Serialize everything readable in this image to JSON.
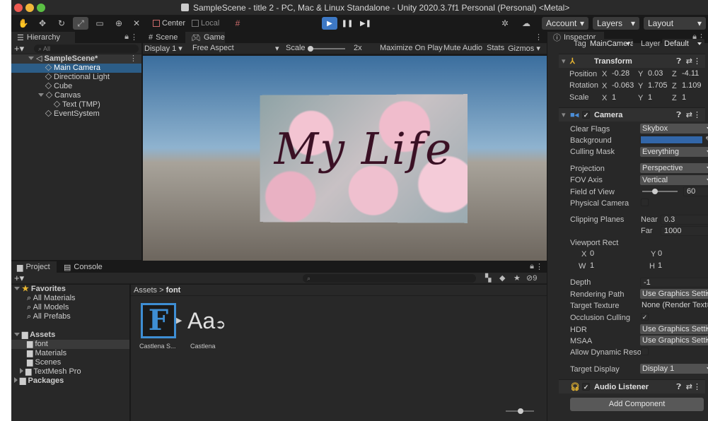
{
  "window": {
    "title": "SampleScene - title 2 - PC, Mac & Linux Standalone - Unity 2020.3.7f1 Personal (Personal) <Metal>"
  },
  "toolbar": {
    "pivot_center": "Center",
    "pivot_local": "Local",
    "account": "Account",
    "layers": "Layers",
    "layout": "Layout"
  },
  "hierarchy": {
    "tab": "Hierarchy",
    "search_placeholder": "All",
    "scene": "SampleScene*",
    "items": [
      "Main Camera",
      "Directional Light",
      "Cube",
      "Canvas",
      "Text (TMP)",
      "EventSystem"
    ]
  },
  "sceneview": {
    "tab_scene": "Scene",
    "tab_game": "Game",
    "display": "Display 1",
    "aspect": "Free Aspect",
    "scale_label": "Scale",
    "scale_value": "2x",
    "maximize": "Maximize On Play",
    "mute": "Mute Audio",
    "stats": "Stats",
    "gizmos": "Gizmos",
    "game_text": "My Life"
  },
  "project": {
    "tab_project": "Project",
    "tab_console": "Console",
    "favorites": "Favorites",
    "fav_items": [
      "All Materials",
      "All Models",
      "All Prefabs"
    ],
    "assets": "Assets",
    "asset_folders": [
      "font",
      "Materials",
      "Scenes",
      "TextMesh Pro"
    ],
    "packages": "Packages",
    "breadcrumb_root": "Assets",
    "breadcrumb_sep": ">",
    "breadcrumb_current": "font",
    "hidden_count": "9",
    "file1_label": "Castlena S...",
    "file2_label": "Castlena",
    "file1_glyph": "F",
    "file2_glyph": "Aa"
  },
  "inspector": {
    "tab": "Inspector",
    "tag_label": "Tag",
    "tag_value": "MainCamera",
    "layer_label": "Layer",
    "layer_value": "Default",
    "transform": {
      "title": "Transform",
      "position_label": "Position",
      "rotation_label": "Rotation",
      "scale_label": "Scale",
      "position": [
        "-0.28",
        "0.03",
        "-4.11"
      ],
      "rotation": [
        "-0.063",
        "1.705",
        "1.109"
      ],
      "scale": [
        "1",
        "1",
        "1"
      ]
    },
    "camera": {
      "title": "Camera",
      "clear_flags_label": "Clear Flags",
      "clear_flags": "Skybox",
      "background_label": "Background",
      "background_color": "#3266a8",
      "culling_mask_label": "Culling Mask",
      "culling_mask": "Everything",
      "projection_label": "Projection",
      "projection": "Perspective",
      "fov_axis_label": "FOV Axis",
      "fov_axis": "Vertical",
      "fov_label": "Field of View",
      "fov": "60",
      "physical_label": "Physical Camera",
      "clipping_label": "Clipping Planes",
      "near_label": "Near",
      "near": "0.3",
      "far_label": "Far",
      "far": "1000",
      "viewport_label": "Viewport Rect",
      "vx": "0",
      "vy": "0",
      "vw": "1",
      "vh": "1",
      "depth_label": "Depth",
      "depth": "-1",
      "rendering_path_label": "Rendering Path",
      "rendering_path": "Use Graphics Settir",
      "target_texture_label": "Target Texture",
      "target_texture": "None (Render Text",
      "occlusion_label": "Occlusion Culling",
      "hdr_label": "HDR",
      "hdr": "Use Graphics Settir",
      "msaa_label": "MSAA",
      "msaa": "Use Graphics Settir",
      "dynres_label": "Allow Dynamic Resol",
      "target_display_label": "Target Display",
      "target_display": "Display 1"
    },
    "audio_listener": "Audio Listener",
    "add_component": "Add Component"
  }
}
